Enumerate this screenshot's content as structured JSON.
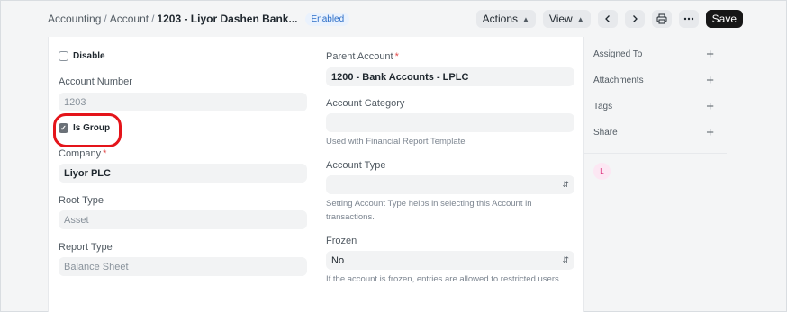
{
  "breadcrumb": {
    "items": [
      "Accounting",
      "Account"
    ],
    "current": "1203 - Liyor Dashen Bank...",
    "separator": "/"
  },
  "status_badge": "Enabled",
  "toolbar": {
    "actions_label": "Actions",
    "view_label": "View",
    "save_label": "Save"
  },
  "form": {
    "disable_label": "Disable",
    "account_number": {
      "label": "Account Number",
      "value": "1203"
    },
    "is_group": {
      "label": "Is Group",
      "checked": true
    },
    "company": {
      "label": "Company",
      "value": "Liyor PLC",
      "required_mark": "*"
    },
    "root_type": {
      "label": "Root Type",
      "value": "Asset"
    },
    "report_type": {
      "label": "Report Type",
      "value": "Balance Sheet"
    },
    "parent_account": {
      "label": "Parent Account",
      "value": "1200 - Bank Accounts - LPLC",
      "required_mark": "*"
    },
    "account_category": {
      "label": "Account Category",
      "value": "",
      "help": "Used with Financial Report Template"
    },
    "account_type": {
      "label": "Account Type",
      "value": "",
      "help": "Setting Account Type helps in selecting this Account in transactions."
    },
    "frozen": {
      "label": "Frozen",
      "value": "No",
      "help": "If the account is frozen, entries are allowed to restricted users."
    }
  },
  "sidebar": {
    "items": [
      {
        "label": "Assigned To"
      },
      {
        "label": "Attachments"
      },
      {
        "label": "Tags"
      },
      {
        "label": "Share"
      }
    ],
    "avatar_initial": "L"
  },
  "colors": {
    "annotation_highlight": "#e4141a",
    "primary_button": "#171717",
    "badge_text": "#2a6dc7"
  }
}
